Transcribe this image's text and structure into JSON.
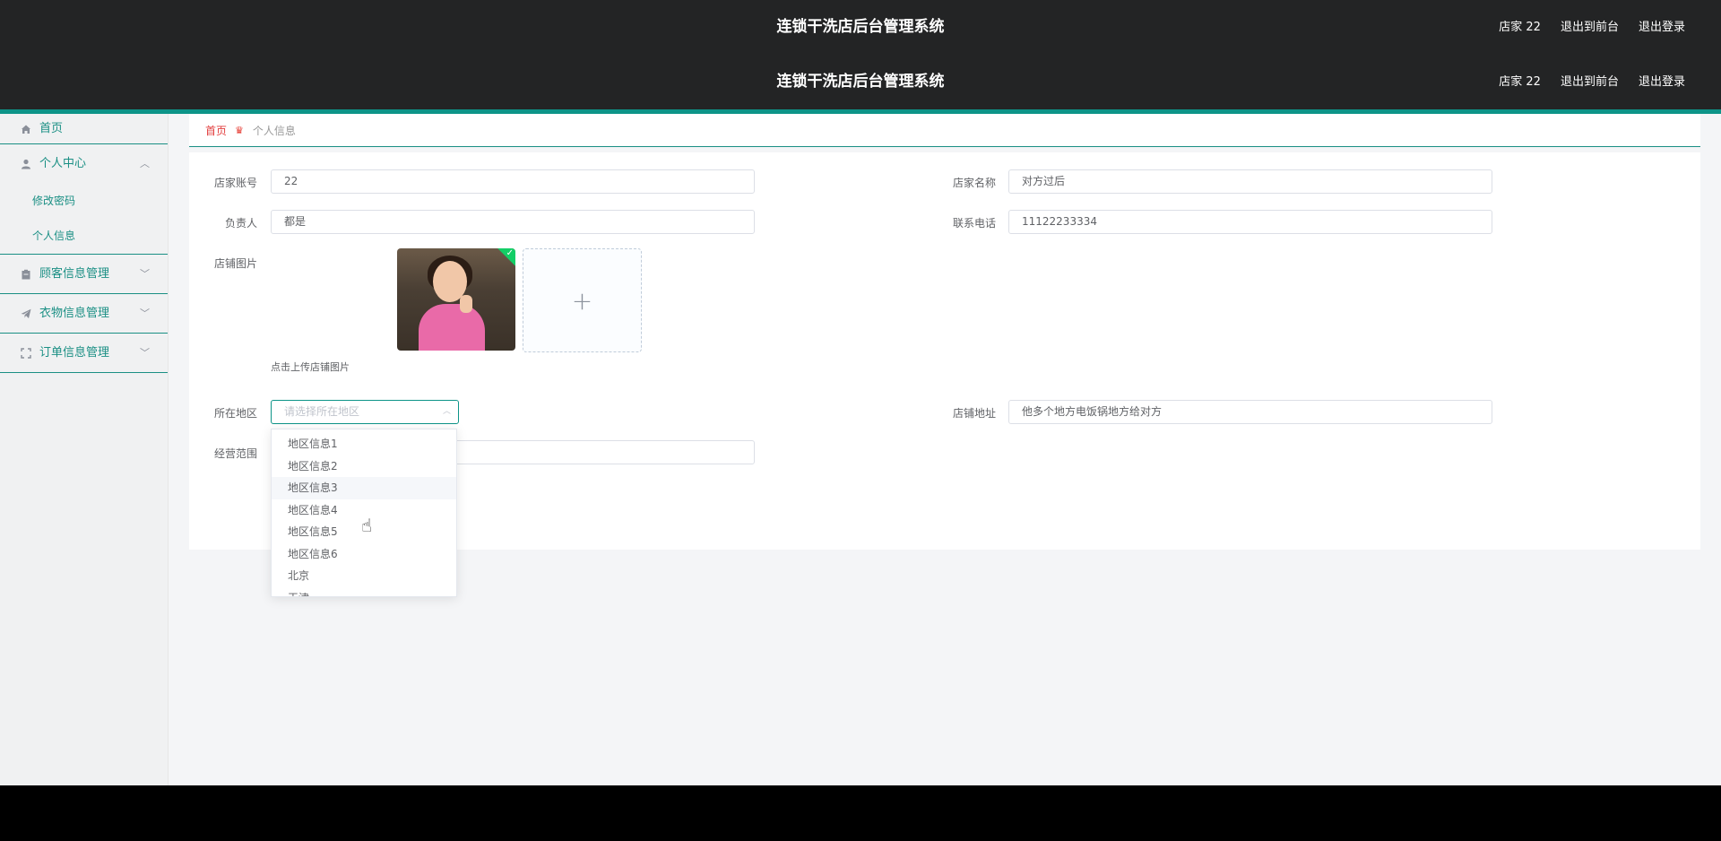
{
  "header": {
    "title": "连锁干洗店后台管理系统",
    "user": "店家 22",
    "to_front": "退出到前台",
    "logout": "退出登录"
  },
  "sidebar": {
    "home": "首页",
    "personal_center": "个人中心",
    "change_password": "修改密码",
    "personal_info": "个人信息",
    "customer_mgmt": "顾客信息管理",
    "clothes_mgmt": "衣物信息管理",
    "order_mgmt": "订单信息管理"
  },
  "breadcrumb": {
    "home": "首页",
    "current": "个人信息"
  },
  "form": {
    "account_label": "店家账号",
    "account_value": "22",
    "shop_name_label": "店家名称",
    "shop_name_value": "对方过后",
    "manager_label": "负责人",
    "manager_value": "都是",
    "phone_label": "联系电话",
    "phone_value": "11122233334",
    "shop_image_label": "店铺图片",
    "upload_hint": "点击上传店铺图片",
    "region_label": "所在地区",
    "region_placeholder": "请选择所在地区",
    "address_label": "店铺地址",
    "address_value": "他多个地方电饭锅地方给对方",
    "scope_label": "经营范围",
    "scope_value": ""
  },
  "region_options": [
    "地区信息1",
    "地区信息2",
    "地区信息3",
    "地区信息4",
    "地区信息5",
    "地区信息6",
    "北京",
    "天津"
  ],
  "colors": {
    "header_bg": "#232425",
    "accent": "#0d9488",
    "sidebar_text": "#1a8f84",
    "breadcrumb_home": "#e23d3d"
  }
}
